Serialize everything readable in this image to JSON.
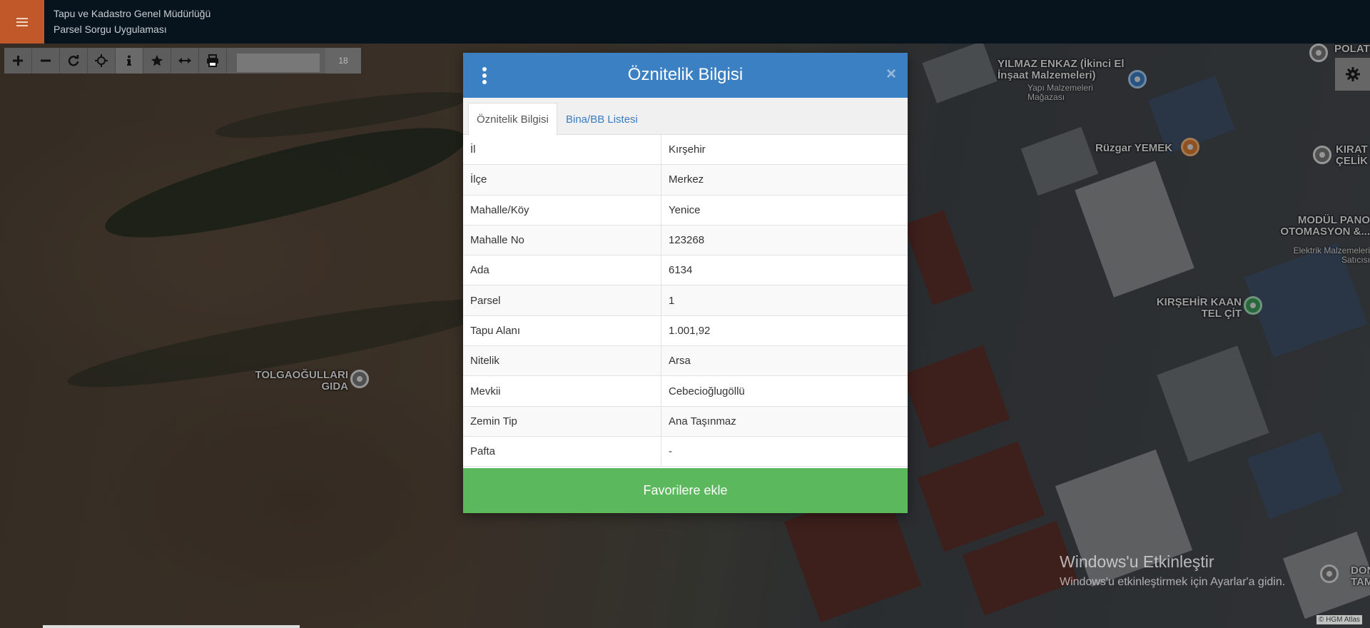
{
  "header": {
    "line1": "Tapu ve Kadastro Genel Müdürlüğü",
    "line2": "Parsel Sorgu Uygulaması"
  },
  "toolbar": {
    "zoom_level": "18",
    "tools": [
      "zoom-in-icon",
      "zoom-out-icon",
      "refresh-icon",
      "locate-icon",
      "info-icon",
      "star-icon",
      "measure-icon",
      "print-icon"
    ]
  },
  "map": {
    "labels": {
      "yilmaz": "YILMAZ ENKAZ (İkinci El İnşaat Malzemeleri)",
      "yilmaz_sub": "Yapı Malzemeleri Mağazası",
      "ruzgar": "Rüzgar YEMEK",
      "polat": "POLAT",
      "kirat": "KIRAT /ÇELİK",
      "modul": "MODÜL PANO OTOMASYON &...",
      "modul_sub": "Elektrik Malzemeleri Satıcısı",
      "kaan": "KIRŞEHİR KAAN TEL ÇİT",
      "tolga": "TOLGAOĞULLARI GIDA",
      "don": "DON TAM"
    },
    "attribution": "© HGM Atlas"
  },
  "windows_notice": {
    "title": "Windows'u Etkinleştir",
    "subtitle": "Windows'u etkinleştirmek için Ayarlar'a gidin."
  },
  "modal": {
    "title": "Öznitelik Bilgisi",
    "close": "×",
    "tabs": [
      "Öznitelik Bilgisi",
      "Bina/BB Listesi"
    ],
    "rows": [
      {
        "key": "İl",
        "value": "Kırşehir"
      },
      {
        "key": "İlçe",
        "value": "Merkez"
      },
      {
        "key": "Mahalle/Köy",
        "value": "Yenice"
      },
      {
        "key": "Mahalle No",
        "value": "123268"
      },
      {
        "key": "Ada",
        "value": "6134"
      },
      {
        "key": "Parsel",
        "value": "1"
      },
      {
        "key": "Tapu Alanı",
        "value": "1.001,92"
      },
      {
        "key": "Nitelik",
        "value": "Arsa"
      },
      {
        "key": "Mevkii",
        "value": "Cebecioğlugöllü"
      },
      {
        "key": "Zemin Tip",
        "value": "Ana Taşınmaz"
      },
      {
        "key": "Pafta",
        "value": "-"
      }
    ],
    "favorite_button": "Favorilere ekle"
  }
}
